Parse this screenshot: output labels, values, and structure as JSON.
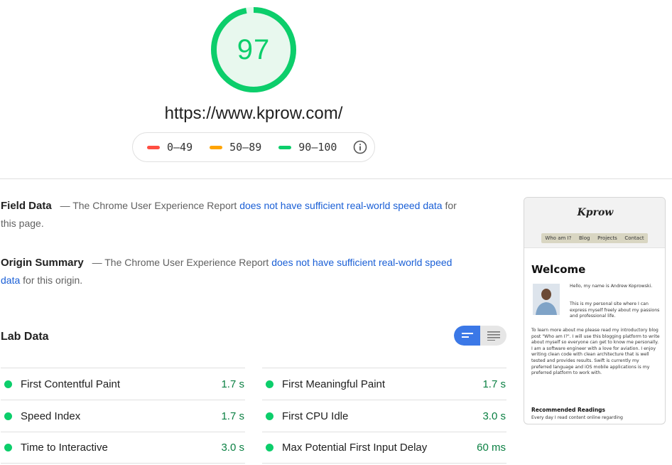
{
  "score": {
    "value": "97",
    "fraction": 0.97,
    "color": "#0cce6b",
    "track_color": "#e4f8ec"
  },
  "url": "https://www.kprow.com/",
  "legend": {
    "items": [
      {
        "range": "0–49",
        "color": "#ff4e42"
      },
      {
        "range": "50–89",
        "color": "#ffa400"
      },
      {
        "range": "90–100",
        "color": "#0cce6b"
      }
    ],
    "info_icon": "info-icon"
  },
  "field_data": {
    "title": "Field Data",
    "prefix": "— The Chrome User Experience Report",
    "link": "does not have sufficient real-world speed data",
    "suffix": "for this page."
  },
  "origin_summary": {
    "title": "Origin Summary",
    "prefix": "— The Chrome User Experience Report",
    "link": "does not have sufficient real-world speed data",
    "suffix": "for this origin."
  },
  "lab_data": {
    "title": "Lab Data",
    "toggle": {
      "active": "list-view-icon",
      "inactive": "text-view-icon"
    },
    "metrics": [
      {
        "name": "First Contentful Paint",
        "value": "1.7 s"
      },
      {
        "name": "First Meaningful Paint",
        "value": "1.7 s"
      },
      {
        "name": "Speed Index",
        "value": "1.7 s"
      },
      {
        "name": "First CPU Idle",
        "value": "3.0 s"
      },
      {
        "name": "Time to Interactive",
        "value": "3.0 s"
      },
      {
        "name": "Max Potential First Input Delay",
        "value": "60 ms"
      }
    ]
  },
  "thumbnail": {
    "logo": "Kprow",
    "nav": [
      "Who am I?",
      "Blog",
      "Projects",
      "Contact"
    ],
    "heading": "Welcome",
    "intro_1": "Hello, my name is Andrew Koprowski.",
    "intro_2": "This is my personal site where I can express myself freely about my passions and professional life.",
    "body": "To learn more about me please read my introductory blog post \"Who am I?\". I will use this blogging platform to write about myself so everyone can get to know me personally. I am a software engineer with a love for aviation. I enjoy writing clean code with clean architecture that is well tested and provides results. Swift is currently my preferred language and iOS mobile applications is my preferred platform to work with.",
    "rec_heading": "Recommended Readings",
    "rec_text": "Every day I read content online regarding"
  }
}
